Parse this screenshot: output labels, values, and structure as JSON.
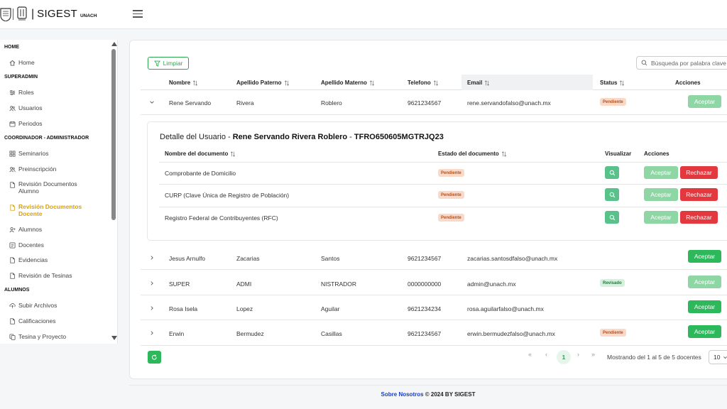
{
  "app": {
    "brand": "SIGEST",
    "brand_sub": "UNACH",
    "brand_bar": "|"
  },
  "sidebar": {
    "sections": [
      {
        "label": "HOME",
        "items": [
          {
            "label": "Home",
            "icon": "home-icon"
          }
        ]
      },
      {
        "label": "SUPERADMIN",
        "items": [
          {
            "label": "Roles",
            "icon": "sliders-icon"
          },
          {
            "label": "Usuarios",
            "icon": "users-icon"
          },
          {
            "label": "Periodos",
            "icon": "calendar-icon"
          }
        ]
      },
      {
        "label": "COORDINADOR - ADMINISTRADOR",
        "items": [
          {
            "label": "Seminarios",
            "icon": "grid-icon"
          },
          {
            "label": "Preinscripción",
            "icon": "users-icon"
          },
          {
            "label": "Revisión Documentos Alumno",
            "icon": "document-icon"
          },
          {
            "label": "Revisión Documentos Docente",
            "icon": "document-icon",
            "active": true
          },
          {
            "label": "Alumnos",
            "icon": "user-icon"
          },
          {
            "label": "Docentes",
            "icon": "list-icon"
          },
          {
            "label": "Evidencias",
            "icon": "document-icon"
          },
          {
            "label": "Revisión de Tesinas",
            "icon": "document-icon"
          }
        ]
      },
      {
        "label": "ALUMNOS",
        "items": [
          {
            "label": "Subir Archivos",
            "icon": "upload-icon"
          },
          {
            "label": "Calificaciones",
            "icon": "document-icon"
          },
          {
            "label": "Tesina y Proyecto",
            "icon": "copy-icon"
          }
        ]
      }
    ]
  },
  "toolbar": {
    "clear_label": "Limpiar",
    "search_placeholder": "Búsqueda por palabra clave"
  },
  "table": {
    "columns": [
      "Nombre",
      "Apellido Paterno",
      "Apellido Materno",
      "Telefono",
      "Email",
      "Status",
      "Acciones"
    ],
    "accept_label": "Aceptar",
    "rows": [
      {
        "nombre": "Rene Servando",
        "paterno": "Rivera",
        "materno": "Roblero",
        "telefono": "9621234567",
        "email": "rene.servandofalso@unach.mx",
        "status": "Pendiente",
        "expanded": true,
        "accept_enabled": false
      },
      {
        "nombre": "Jesus Arnulfo",
        "paterno": "Zacarias",
        "materno": "Santos",
        "telefono": "9621234567",
        "email": "zacarias.santosdfalso@unach.mx",
        "status": "",
        "expanded": false,
        "accept_enabled": true
      },
      {
        "nombre": "SUPER",
        "paterno": "ADMI",
        "materno": "NISTRADOR",
        "telefono": "0000000000",
        "email": "admin@unach.mx",
        "status": "Revisado",
        "expanded": false,
        "accept_enabled": false
      },
      {
        "nombre": "Rosa Isela",
        "paterno": "Lopez",
        "materno": "Aguilar",
        "telefono": "9621234234",
        "email": "rosa.aguilarfalso@unach.mx",
        "status": "",
        "expanded": false,
        "accept_enabled": true
      },
      {
        "nombre": "Erwin",
        "paterno": "Bermudez",
        "materno": "Casillas",
        "telefono": "9621234567",
        "email": "erwin.bermudezfalso@unach.mx",
        "status": "Pendiente",
        "expanded": false,
        "accept_enabled": true
      }
    ]
  },
  "detail": {
    "title_prefix": "Detalle del Usuario - ",
    "user_name": "Rene Servando Rivera Roblero",
    "separator": " - ",
    "user_id": "TFRO650605MGTRJQ23",
    "columns": [
      "Nombre del documento",
      "Estado del documento",
      "Visualizar",
      "Acciones"
    ],
    "accept_label": "Aceptar",
    "reject_label": "Rechazar",
    "documents": [
      {
        "name": "Comprobante de Domicilio",
        "status": "Pendiente"
      },
      {
        "name": "CURP (Clave Única de Registro de Población)",
        "status": "Pendiente"
      },
      {
        "name": "Registro Federal de Contribuyentes (RFC)",
        "status": "Pendiente"
      }
    ]
  },
  "pagination": {
    "first": "«",
    "prev": "‹",
    "current_page": "1",
    "next": "›",
    "last": "»",
    "summary": "Mostrando del 1 al 5 de 5 docentes",
    "page_size": "10"
  },
  "footer": {
    "link": "Sobre Nosotros",
    "text": " © 2024 BY SIGEST"
  },
  "colors": {
    "accent_green": "#2eb85c",
    "active_gold": "#d4a017",
    "danger_red": "#e3383e",
    "footer_link": "#1a3dbf"
  }
}
